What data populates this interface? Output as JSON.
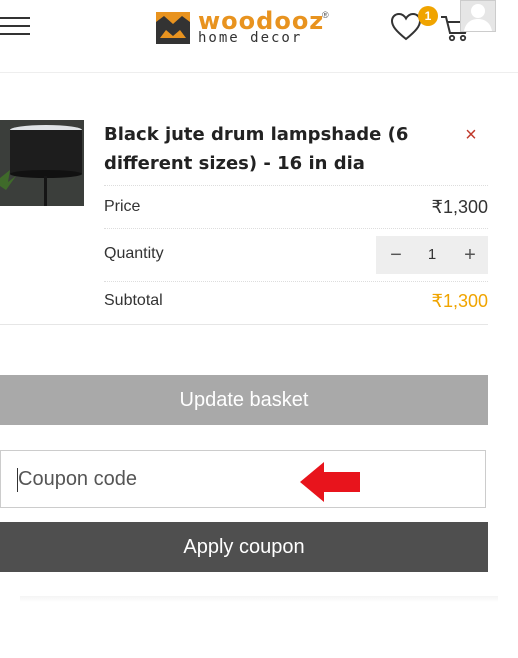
{
  "header": {
    "logo_brand": "woodooz",
    "logo_registered": "®",
    "logo_tagline": "home decor",
    "wishlist_count": "1"
  },
  "cart_item": {
    "title": "Black jute drum lampshade (6 different sizes) - 16 in dia",
    "remove_symbol": "×",
    "price_label": "Price",
    "price_value": "₹1,300",
    "quantity_label": "Quantity",
    "quantity_value": "1",
    "qty_minus": "−",
    "qty_plus": "+",
    "subtotal_label": "Subtotal",
    "subtotal_value": "₹1,300"
  },
  "actions": {
    "update_label": "Update basket",
    "coupon_placeholder": "Coupon code",
    "apply_label": "Apply coupon"
  },
  "colors": {
    "accent": "#f0a400",
    "remove": "#c0392b",
    "arrow": "#e8141c"
  }
}
